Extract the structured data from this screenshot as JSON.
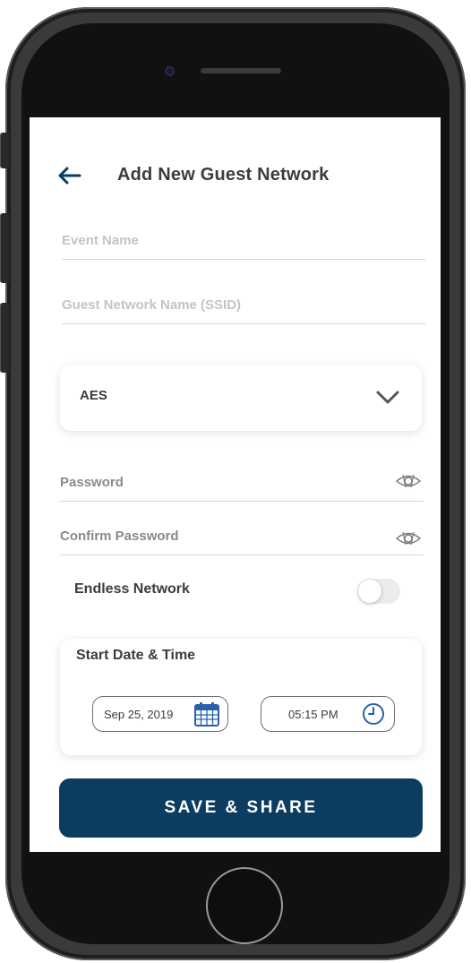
{
  "header": {
    "title": "Add New Guest Network",
    "back_icon": "arrow-left-icon"
  },
  "form": {
    "event_name": {
      "placeholder": "Event Name",
      "value": ""
    },
    "ssid": {
      "placeholder": "Guest Network Name (SSID)",
      "value": ""
    },
    "encryption": {
      "selected": "AES",
      "icon": "chevron-down-icon"
    },
    "password": {
      "placeholder": "Password",
      "value": "",
      "icon": "eye-icon"
    },
    "confirm_password": {
      "placeholder": "Confirm Password",
      "value": "",
      "icon": "eye-icon"
    },
    "endless_network": {
      "label": "Endless Network",
      "enabled": false
    },
    "start": {
      "title": "Start Date & Time",
      "date": "Sep 25, 2019",
      "time": "05:15 PM",
      "date_icon": "calendar-icon",
      "time_icon": "clock-icon"
    }
  },
  "actions": {
    "save_label": "SAVE & SHARE"
  },
  "colors": {
    "primary": "#0d3c61",
    "accent_icon": "#2a5fb0",
    "text": "#3c3c3c",
    "placeholder": "#c4c4c4"
  }
}
